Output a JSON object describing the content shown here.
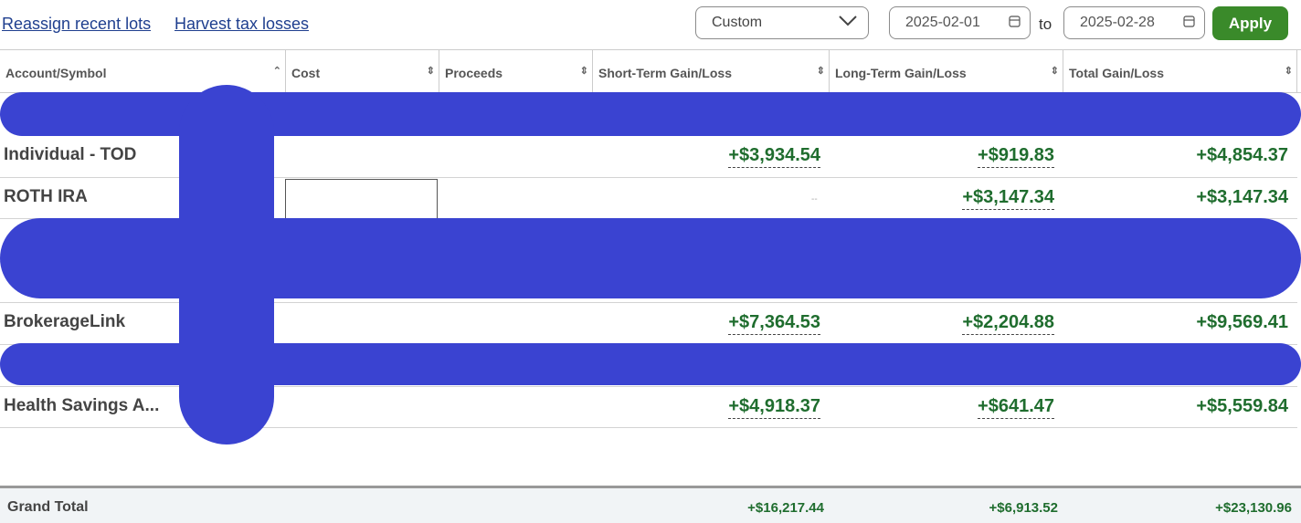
{
  "links": {
    "reassign": "Reassign recent lots",
    "harvest": "Harvest tax losses"
  },
  "filters": {
    "range": "Custom",
    "start_date": "2025-02-01",
    "to_label": "to",
    "end_date": "2025-02-28",
    "apply_label": "Apply"
  },
  "columns": [
    "Account/Symbol",
    "Cost",
    "Proceeds",
    "Short-Term Gain/Loss",
    "Long-Term Gain/Loss",
    "Total Gain/Loss"
  ],
  "rows": [
    {
      "account": "Individual - TOD",
      "short_term": "+$3,934.54",
      "long_term": "+$919.83",
      "total": "+$4,854.37"
    },
    {
      "account": "ROTH IRA",
      "short_term": "--",
      "long_term": "+$3,147.34",
      "total": "+$3,147.34"
    },
    {
      "account": "BrokerageLink",
      "short_term": "+$7,364.53",
      "long_term": "+$2,204.88",
      "total": "+$9,569.41"
    },
    {
      "account": "Health Savings A...",
      "short_term": "+$4,918.37",
      "long_term": "+$641.47",
      "total": "+$5,559.84"
    }
  ],
  "grand_total": {
    "label": "Grand Total",
    "short_term": "+$16,217.44",
    "long_term": "+$6,913.52",
    "total": "+$23,130.96"
  },
  "colors": {
    "gain": "#1f6d2e",
    "apply": "#3a8a2a",
    "link": "#1f3f8f",
    "redaction": "#3a43d1"
  },
  "icons": {
    "dropdown": "chevron-down-icon",
    "calendar": "calendar-icon",
    "sort": "sort-icon"
  }
}
